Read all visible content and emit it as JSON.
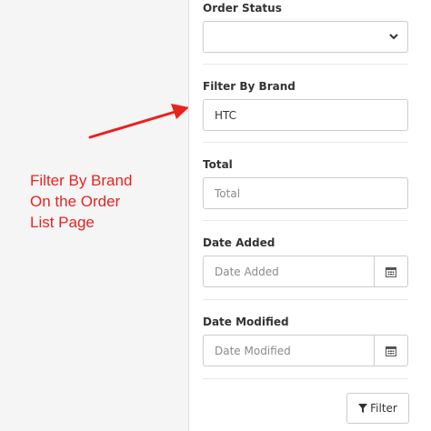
{
  "annotation": {
    "lines": [
      "Filter By Brand",
      "On the Order",
      "List Page"
    ],
    "color": "#e8231f"
  },
  "filters": {
    "order_status": {
      "label": "Order Status",
      "value": ""
    },
    "brand": {
      "label": "Filter By Brand",
      "value": "HTC"
    },
    "total": {
      "label": "Total",
      "placeholder": "Total"
    },
    "date_added": {
      "label": "Date Added",
      "placeholder": "Date Added",
      "icon": "calendar-icon"
    },
    "date_modified": {
      "label": "Date Modified",
      "placeholder": "Date Modified",
      "icon": "calendar-icon"
    }
  },
  "filter_button": {
    "label": "Filter",
    "icon": "funnel-icon"
  }
}
